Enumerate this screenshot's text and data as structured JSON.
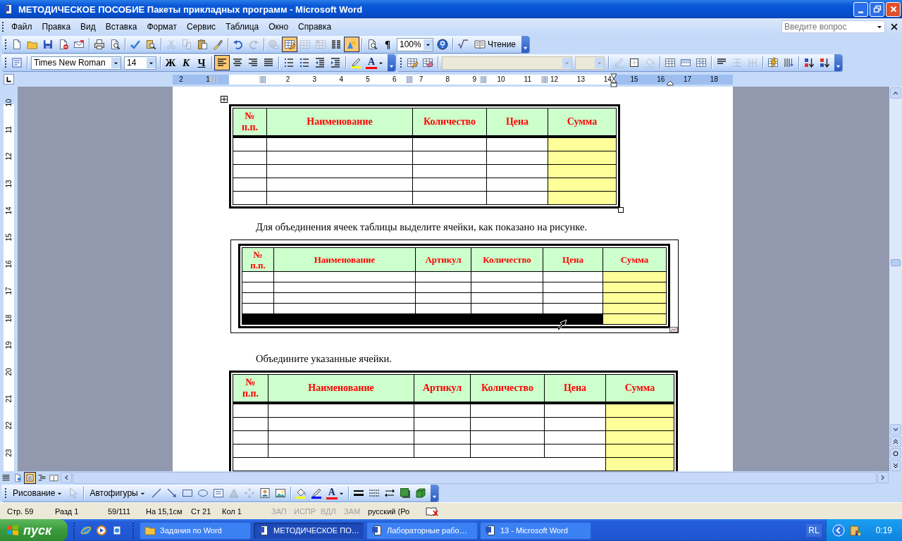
{
  "window": {
    "title": "МЕТОДИЧЕСКОЕ ПОСОБИЕ Пакеты прикладных программ - Microsoft Word"
  },
  "menu": [
    "Файл",
    "Правка",
    "Вид",
    "Вставка",
    "Формат",
    "Сервис",
    "Таблица",
    "Окно",
    "Справка"
  ],
  "help_search": {
    "placeholder": "Введите вопрос"
  },
  "standard_toolbar": [
    [
      {
        "kind": "icon",
        "pressed": false,
        "disabled": false
      },
      {
        "kind": "icon",
        "pressed": false,
        "disabled": false
      },
      {
        "kind": "icon",
        "pressed": false,
        "disabled": false
      },
      {
        "kind": "icon",
        "pressed": false,
        "disabled": false
      },
      {
        "kind": "icon",
        "pressed": false,
        "disabled": false
      }
    ],
    [
      {
        "kind": "icon",
        "pressed": false,
        "disabled": false
      },
      {
        "kind": "icon",
        "pressed": false,
        "disabled": false
      }
    ],
    [
      {
        "kind": "icon",
        "pressed": false,
        "disabled": false
      },
      {
        "kind": "icon",
        "pressed": false,
        "disabled": false
      }
    ],
    [
      {
        "kind": "icon",
        "pressed": false,
        "disabled": true
      },
      {
        "kind": "icon",
        "pressed": false,
        "disabled": true
      },
      {
        "kind": "icon",
        "pressed": false,
        "disabled": false
      },
      {
        "kind": "icon",
        "pressed": false,
        "disabled": false
      }
    ],
    [
      {
        "kind": "icon",
        "pressed": false,
        "disabled": false
      },
      {
        "kind": "icon",
        "pressed": false,
        "disabled": true
      }
    ],
    [
      {
        "kind": "icon",
        "pressed": false,
        "disabled": true
      },
      {
        "kind": "icon",
        "pressed": true,
        "disabled": false
      },
      {
        "kind": "icon",
        "pressed": false,
        "disabled": true
      },
      {
        "kind": "icon",
        "pressed": false,
        "disabled": true
      },
      {
        "kind": "icon",
        "pressed": false,
        "disabled": false
      },
      {
        "kind": "icon",
        "pressed": true,
        "disabled": false
      }
    ],
    [
      {
        "kind": "icon",
        "pressed": false,
        "disabled": false
      },
      {
        "kind": "label",
        "label": "¶",
        "pressed": false
      },
      {
        "kind": "field",
        "value": "100%",
        "disabled": false
      },
      {
        "kind": "icon",
        "pressed": false,
        "disabled": false
      }
    ],
    [
      {
        "kind": "icon",
        "pressed": false,
        "disabled": false
      },
      {
        "kind": "icon-label",
        "label": "Чтение",
        "pressed": false,
        "disabled": false
      }
    ]
  ],
  "formatting_toolbar": [
    [
      {
        "kind": "icon",
        "pressed": false,
        "disabled": false
      }
    ],
    [
      {
        "kind": "field",
        "value": "Times New Roman",
        "disabled": false
      },
      {
        "kind": "field",
        "value": "14",
        "disabled": false
      }
    ],
    [
      {
        "kind": "label",
        "label": "Ж",
        "pressed": false
      },
      {
        "kind": "label",
        "label": "К",
        "pressed": false
      },
      {
        "kind": "label",
        "label": "Ч",
        "pressed": false
      }
    ],
    [
      {
        "kind": "icon",
        "pressed": true,
        "disabled": false
      },
      {
        "kind": "icon",
        "pressed": false,
        "disabled": false
      },
      {
        "kind": "icon",
        "pressed": false,
        "disabled": false
      },
      {
        "kind": "icon",
        "pressed": false,
        "disabled": false
      }
    ],
    [
      {
        "kind": "icon",
        "pressed": false,
        "disabled": false
      },
      {
        "kind": "icon",
        "pressed": false,
        "disabled": false
      },
      {
        "kind": "icon",
        "pressed": false,
        "disabled": false
      },
      {
        "kind": "icon",
        "pressed": false,
        "disabled": false
      }
    ],
    [
      {
        "kind": "icon",
        "pressed": false,
        "disabled": false
      },
      {
        "kind": "color-label",
        "label": "A",
        "color": "#ff0000"
      }
    ]
  ],
  "tables_toolbar": [
    [
      {
        "kind": "icon",
        "pressed": false,
        "disabled": false
      },
      {
        "kind": "icon",
        "pressed": false,
        "disabled": false
      }
    ],
    [
      {
        "kind": "field",
        "disabled": true
      },
      {
        "kind": "field",
        "disabled": true
      }
    ],
    [
      {
        "kind": "icon",
        "pressed": false,
        "disabled": true
      },
      {
        "kind": "icon",
        "pressed": false,
        "disabled": false
      },
      {
        "kind": "icon",
        "pressed": false,
        "disabled": true
      }
    ],
    [
      {
        "kind": "icon",
        "pressed": false,
        "disabled": false
      },
      {
        "kind": "icon",
        "pressed": false,
        "disabled": false
      },
      {
        "kind": "icon",
        "pressed": false,
        "disabled": false
      }
    ],
    [
      {
        "kind": "icon",
        "pressed": false,
        "disabled": false
      },
      {
        "kind": "icon",
        "pressed": false,
        "disabled": true
      },
      {
        "kind": "icon",
        "pressed": false,
        "disabled": true
      }
    ],
    [
      {
        "kind": "icon",
        "pressed": false,
        "disabled": false
      },
      {
        "kind": "icon",
        "pressed": false,
        "disabled": false
      }
    ],
    [
      {
        "kind": "icon",
        "pressed": false,
        "disabled": false
      },
      {
        "kind": "icon",
        "pressed": false,
        "disabled": false
      }
    ]
  ],
  "ruler": {
    "horizontal": [
      "2",
      "1",
      "2",
      "3",
      "4",
      "5",
      "6",
      "7",
      "8",
      "9",
      "10",
      "11",
      "12",
      "13",
      "14",
      "15",
      "16",
      "17",
      "18"
    ],
    "vertical": [
      "10",
      "11",
      "12",
      "13",
      "14",
      "15",
      "16",
      "17",
      "18",
      "19",
      "20",
      "21",
      "22",
      "23"
    ]
  },
  "document": {
    "blocks": [
      {
        "kind": "table",
        "active": true,
        "columns": [
          {
            "label": "№ п.п.",
            "color": "#ffffff"
          },
          {
            "label": "Наименование",
            "color": "#ffffff"
          },
          {
            "label": "Количество",
            "color": "#ffffff"
          },
          {
            "label": "Цена",
            "color": "#ffffff"
          },
          {
            "label": "Сумма",
            "color": "#ffff99"
          }
        ],
        "rows": [
          {
            "kind": "plain",
            "selected": false
          },
          {
            "kind": "plain",
            "selected": false
          },
          {
            "kind": "plain",
            "selected": false
          },
          {
            "kind": "plain",
            "selected": false
          },
          {
            "kind": "plain",
            "selected": false
          }
        ]
      },
      {
        "kind": "paragraph",
        "text": "Для объединения ячеек таблицы выделите ячейки, как показано на рисунке."
      },
      {
        "kind": "framed-table",
        "columns": [
          {
            "label": "№ п.п.",
            "color": "#ffffff"
          },
          {
            "label": "Наименование",
            "color": "#ffffff"
          },
          {
            "label": "Артикул",
            "color": "#ffffff"
          },
          {
            "label": "Количество",
            "color": "#ffffff"
          },
          {
            "label": "Цена",
            "color": "#ffffff"
          },
          {
            "label": "Сумма",
            "color": "#ffff99"
          }
        ],
        "rows": [
          {
            "kind": "plain",
            "selected": false
          },
          {
            "kind": "plain",
            "selected": false
          },
          {
            "kind": "plain",
            "selected": false
          },
          {
            "kind": "plain",
            "selected": false
          },
          {
            "kind": "plain",
            "selected": true
          }
        ]
      },
      {
        "kind": "paragraph",
        "text": "Объедините указанные ячейки."
      },
      {
        "kind": "table",
        "columns": [
          {
            "label": "№ п.п.",
            "color": "#ffffff"
          },
          {
            "label": "Наименование",
            "color": "#ffffff"
          },
          {
            "label": "Артикул",
            "color": "#ffffff"
          },
          {
            "label": "Количество",
            "color": "#ffffff"
          },
          {
            "label": "Цена",
            "color": "#ffffff"
          },
          {
            "label": "Сумма",
            "color": "#ffff99"
          }
        ],
        "rows": [
          {
            "kind": "plain",
            "selected": false
          },
          {
            "kind": "plain",
            "selected": false
          },
          {
            "kind": "plain",
            "selected": false
          },
          {
            "kind": "plain",
            "selected": false
          },
          {
            "kind": "merged",
            "selected": false
          }
        ]
      }
    ]
  },
  "view_buttons": [
    {
      "selected": false
    },
    {
      "selected": false
    },
    {
      "selected": true
    },
    {
      "selected": false
    },
    {
      "selected": false
    }
  ],
  "drawing_toolbar": [
    [
      {
        "kind": "menu",
        "label": "Рисование"
      },
      {
        "kind": "icon",
        "pressed": false,
        "disabled": true
      }
    ],
    [
      {
        "kind": "menu",
        "label": "Автофигуры"
      },
      {
        "kind": "icon",
        "pressed": false,
        "disabled": false
      },
      {
        "kind": "icon",
        "pressed": false,
        "disabled": false
      },
      {
        "kind": "icon",
        "pressed": false,
        "disabled": false
      },
      {
        "kind": "icon",
        "pressed": false,
        "disabled": false
      },
      {
        "kind": "icon",
        "pressed": false,
        "disabled": false
      },
      {
        "kind": "icon",
        "pressed": false,
        "disabled": true
      },
      {
        "kind": "icon",
        "pressed": false,
        "disabled": true
      },
      {
        "kind": "icon",
        "pressed": false,
        "disabled": false
      },
      {
        "kind": "icon",
        "pressed": false,
        "disabled": false
      }
    ],
    [
      {
        "kind": "icon",
        "pressed": false,
        "disabled": false
      },
      {
        "kind": "icon",
        "pressed": false,
        "disabled": false
      },
      {
        "kind": "color-label",
        "label": "A",
        "color": "#ff0000"
      }
    ],
    [
      {
        "kind": "icon",
        "pressed": false,
        "disabled": false
      },
      {
        "kind": "icon",
        "pressed": false,
        "disabled": false
      },
      {
        "kind": "icon",
        "pressed": false,
        "disabled": false
      },
      {
        "kind": "icon",
        "pressed": false,
        "disabled": false
      },
      {
        "kind": "icon",
        "pressed": false,
        "disabled": false
      }
    ]
  ],
  "status_bar": [
    {
      "text": "Стр. 59",
      "disabled": false
    },
    {
      "text": "Разд 1",
      "disabled": false
    },
    {
      "text": "59/111",
      "disabled": false
    },
    {
      "text": "На 15,1см",
      "disabled": false
    },
    {
      "text": "Ст 21",
      "disabled": false
    },
    {
      "text": "Кол 1",
      "disabled": false
    },
    {
      "text": "ЗАП",
      "disabled": true
    },
    {
      "text": "ИСПР",
      "disabled": true
    },
    {
      "text": "ВДЛ",
      "disabled": true
    },
    {
      "text": "ЗАМ",
      "disabled": true
    },
    {
      "text": "русский (Ро",
      "disabled": false
    }
  ],
  "taskbar": {
    "start": "пуск",
    "tasks": [
      {
        "kind": "folder",
        "label": "Задания по Word",
        "selected": false
      },
      {
        "kind": "document",
        "label": "МЕТОДИЧЕСКОЕ ПО…",
        "selected": true
      },
      {
        "kind": "document",
        "label": "Лабораторные рабо…",
        "selected": false
      },
      {
        "kind": "document",
        "label": "13 - Microsoft Word",
        "selected": false
      }
    ],
    "language": "RL",
    "clock": "0:19"
  }
}
